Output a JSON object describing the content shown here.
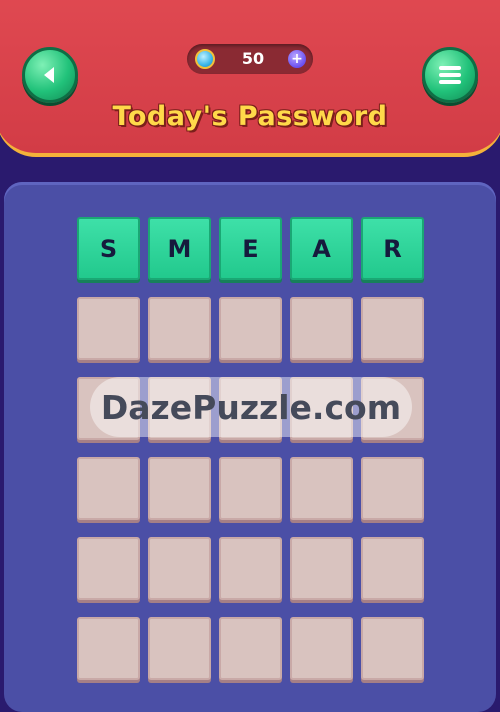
{
  "header": {
    "title": "Today's Password",
    "coins": "50",
    "back_icon": "back-arrow-icon",
    "menu_icon": "menu-icon",
    "plus_icon": "+"
  },
  "grid": {
    "columns": 5,
    "rows": [
      [
        "S",
        "M",
        "E",
        "A",
        "R"
      ],
      [
        "",
        "",
        "",
        "",
        ""
      ],
      [
        "",
        "",
        "",
        "",
        ""
      ],
      [
        "",
        "",
        "",
        "",
        ""
      ],
      [
        "",
        "",
        "",
        "",
        ""
      ],
      [
        "",
        "",
        "",
        "",
        ""
      ]
    ]
  },
  "watermark": "DazePuzzle.com",
  "colors": {
    "header_red": "#d23c46",
    "title_yellow": "#ffd94a",
    "board_blue": "#4b4fa6",
    "tile_green": "#22c98d",
    "tile_empty": "#d9c3bf"
  }
}
